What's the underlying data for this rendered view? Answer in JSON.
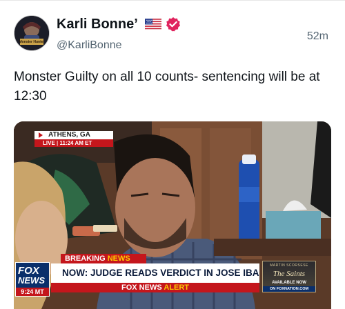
{
  "post": {
    "display_name": "Karli Bonne’",
    "handle": "@KarliBonne",
    "timestamp": "52m",
    "text": "Monster Guilty on all 10 counts- sentencing will be at 12:30",
    "avatar_text": "Monster Hunter",
    "icons": {
      "flag": "us-flag-icon",
      "verified": "verified-badge-icon"
    },
    "colors": {
      "verified": "#e0245e",
      "text": "#0f1419",
      "secondary": "#536471"
    }
  },
  "broadcast": {
    "location": "ATHENS, GA",
    "live_label": "LIVE",
    "live_time": "11:24 AM ET",
    "breaking_label": "BREAKING",
    "breaking_news_word": "NEWS",
    "headline": "NOW: JUDGE READS VERDICT IN JOSE IBARRA TRIAL",
    "network_prefix": "FOX NEWS",
    "network_alert": "ALERT",
    "logo_fox": "FOX",
    "logo_news": "NEWS",
    "logo_time": "9:24 MT",
    "promo": {
      "top": "MARTIN SCORSESE",
      "title": "The Saints",
      "availability": "AVAILABLE NOW",
      "url": "ON FOXNATION.COM"
    },
    "colors": {
      "fox_red": "#c4161c",
      "fox_blue": "#0a2f6b",
      "alert_yellow": "#ffcc00"
    }
  }
}
